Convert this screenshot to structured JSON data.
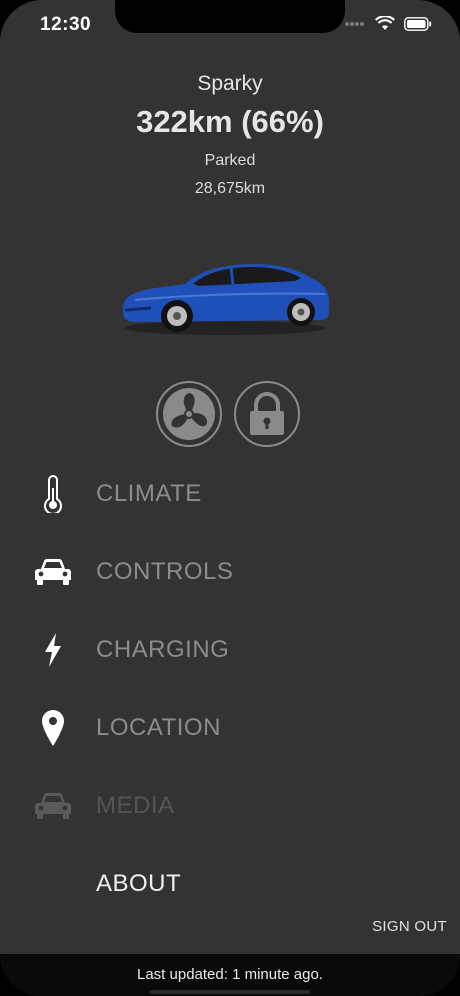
{
  "status_bar": {
    "time": "12:30",
    "icons": [
      "signal-dots-icon",
      "wifi-icon",
      "battery-icon"
    ]
  },
  "vehicle": {
    "name": "Sparky",
    "range": "322km (66%)",
    "state": "Parked",
    "odometer": "28,675km",
    "image": "car-image",
    "color": "#1f4fb8"
  },
  "quick_actions": [
    {
      "icon": "fan-icon",
      "action": "fan"
    },
    {
      "icon": "lock-icon",
      "action": "lock"
    }
  ],
  "menu": {
    "items": [
      {
        "label": "CLIMATE",
        "icon": "thermometer-icon"
      },
      {
        "label": "CONTROLS",
        "icon": "car-icon"
      },
      {
        "label": "CHARGING",
        "icon": "lightning-icon"
      },
      {
        "label": "LOCATION",
        "icon": "location-pin-icon"
      },
      {
        "label": "MEDIA",
        "icon": "car-icon",
        "disabled": true
      },
      {
        "label": "ABOUT"
      }
    ]
  },
  "sign_out_label": "SIGN OUT",
  "footer": {
    "last_updated": "Last updated: 1 minute ago."
  },
  "colors": {
    "background": "#333333",
    "menu_label": "#8c8c8c",
    "disabled": "#555555",
    "footer_bg": "#0a0a0a"
  }
}
